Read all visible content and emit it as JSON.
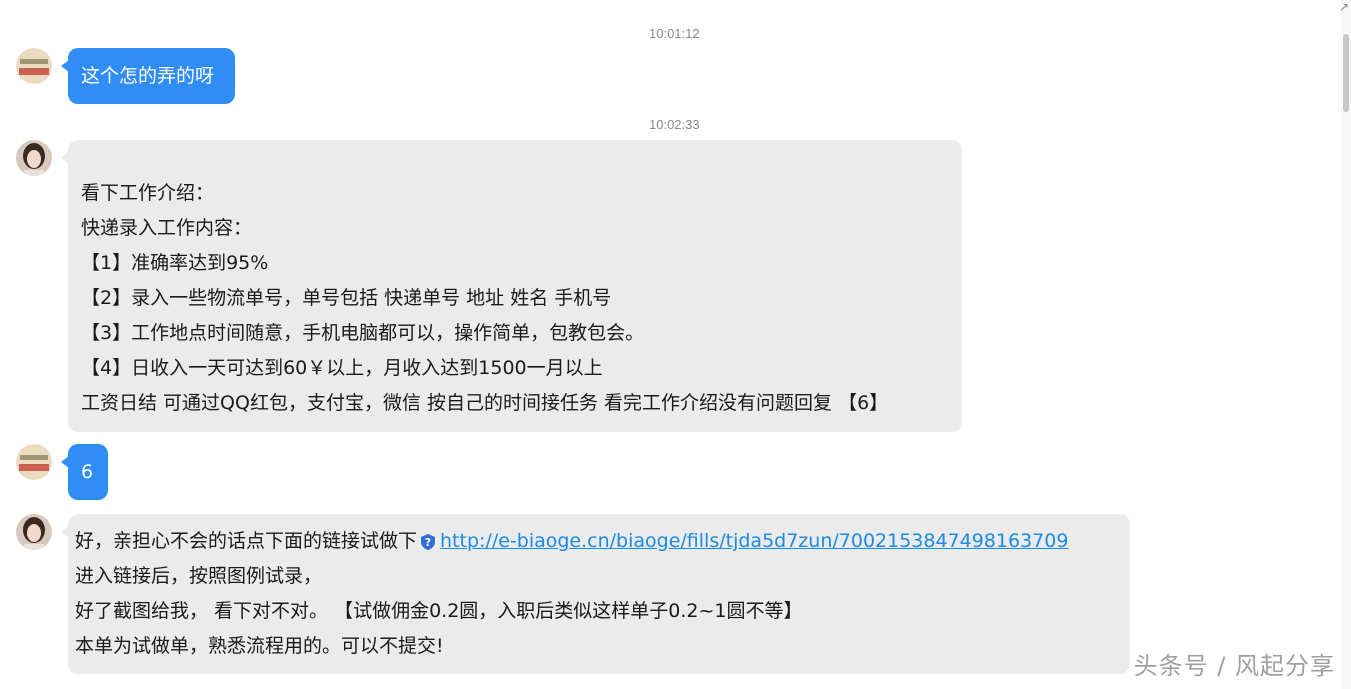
{
  "messages": [
    {
      "timestamp": "10:01:12",
      "sender": "self",
      "lines": [
        "这个怎的弄的呀"
      ]
    },
    {
      "timestamp": "10:02:33",
      "sender": "other",
      "lines": [
        "看下工作介绍：",
        "快递录入工作内容：",
        "【1】准确率达到95%",
        "【2】录入一些物流单号，单号包括 快递单号 地址 姓名  手机号",
        "【3】工作地点时间随意，手机电脑都可以，操作简单，包教包会。",
        "【4】日收入一天可达到60￥以上，月收入达到1500一月以上",
        "工资日结 可通过QQ红包，支付宝，微信    按自己的时间接任务 看完工作介绍没有问题回复 【6】"
      ]
    },
    {
      "sender": "self",
      "lines": [
        "6"
      ]
    },
    {
      "sender": "other",
      "intro": " 好，亲担心不会的话点下面的链接试做下",
      "link": "http://e-biaoge.cn/biaoge/fills/tjda5d7zun/7002153847498163709",
      "lines": [
        "进入链接后，按照图例试录，",
        "好了截图给我，  看下对不对。  【试做佣金0.2圆，入职后类似这样单子0.2~1圆不等】",
        "本单为试做单，熟悉流程用的。可以不提交!"
      ]
    }
  ],
  "icons": {
    "self_avatar": "self-avatar-icon",
    "other_avatar": "contact-avatar-icon",
    "link_security": "question-shield-icon",
    "scroll_arrow": "expand-arrow-icon"
  },
  "colors": {
    "self_bubble": "#2f8df5",
    "other_bubble": "#ebebeb",
    "link": "#1a8be6"
  },
  "watermark": "头条号 / 风起分享"
}
